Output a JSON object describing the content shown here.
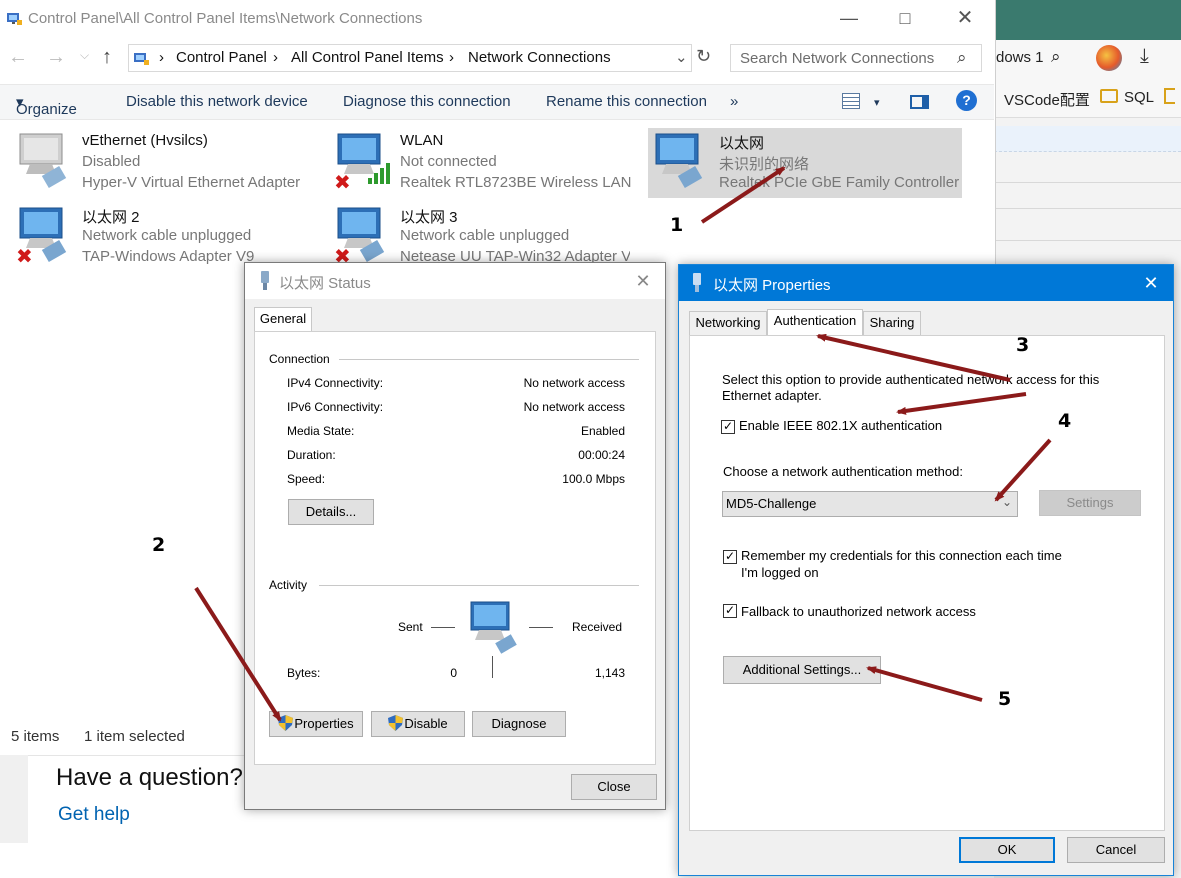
{
  "explorer": {
    "title": "Control Panel\\All Control Panel Items\\Network Connections",
    "breadcrumb": [
      "Control Panel",
      "All Control Panel Items",
      "Network Connections"
    ],
    "search_placeholder": "Search Network Connections",
    "toolbar": {
      "organize": "Organize",
      "disable": "Disable this network device",
      "diagnose": "Diagnose this connection",
      "rename": "Rename this connection",
      "more": "»"
    },
    "connections": [
      {
        "name": "vEthernet (Hvsilcs)",
        "status": "Disabled",
        "adapter": "Hyper-V Virtual Ethernet Adapter"
      },
      {
        "name": "WLAN",
        "status": "Not connected",
        "adapter": "Realtek RTL8723BE Wireless LAN ..."
      },
      {
        "name": "以太网",
        "status": "未识别的网络",
        "adapter": "Realtek PCIe GbE Family Controller"
      },
      {
        "name": "以太网 2",
        "status": "Network cable unplugged",
        "adapter": "TAP-Windows Adapter V9"
      },
      {
        "name": "以太网 3",
        "status": "Network cable unplugged",
        "adapter": "Netease UU TAP-Win32 Adapter V..."
      }
    ],
    "status_bar": {
      "items": "5 items",
      "selected": "1 item selected"
    }
  },
  "help": {
    "question": "Have a question?",
    "link": "Get help"
  },
  "background_browser": {
    "tab_text": "dows 1",
    "bookmark1": "VSCode配置",
    "bookmark2": "SQL"
  },
  "status_dialog": {
    "title": "以太网 Status",
    "tab": "General",
    "connection_label": "Connection",
    "rows": [
      {
        "label": "IPv4 Connectivity:",
        "value": "No network access"
      },
      {
        "label": "IPv6 Connectivity:",
        "value": "No network access"
      },
      {
        "label": "Media State:",
        "value": "Enabled"
      },
      {
        "label": "Duration:",
        "value": "00:00:24"
      },
      {
        "label": "Speed:",
        "value": "100.0 Mbps"
      }
    ],
    "details_button": "Details...",
    "activity_label": "Activity",
    "sent_label": "Sent",
    "received_label": "Received",
    "bytes_label": "Bytes:",
    "bytes_sent": "0",
    "bytes_received": "1,143",
    "properties_button": "Properties",
    "disable_button": "Disable",
    "diagnose_button": "Diagnose",
    "close_button": "Close"
  },
  "properties_dialog": {
    "title": "以太网 Properties",
    "tabs": [
      "Networking",
      "Authentication",
      "Sharing"
    ],
    "active_tab": "Authentication",
    "description_line1": "Select this option to provide authenticated network access for this",
    "description_line2": "Ethernet adapter.",
    "enable_8021x": "Enable IEEE 802.1X authentication",
    "enable_8021x_checked": true,
    "method_label": "Choose a network authentication method:",
    "method_value": "MD5-Challenge",
    "settings_button": "Settings",
    "remember_line1": "Remember my credentials for this connection each time",
    "remember_line2": "I'm logged on",
    "remember_checked": true,
    "fallback": "Fallback to unauthorized network access",
    "fallback_checked": true,
    "additional_settings_button": "Additional Settings...",
    "ok_button": "OK",
    "cancel_button": "Cancel"
  },
  "annotations": [
    "1",
    "2",
    "3",
    "4",
    "5"
  ],
  "colors": {
    "arrow": "#8b1a1a",
    "accent": "#0078d7",
    "help_link": "#0063b1",
    "toolbar_text": "#1e395b"
  }
}
